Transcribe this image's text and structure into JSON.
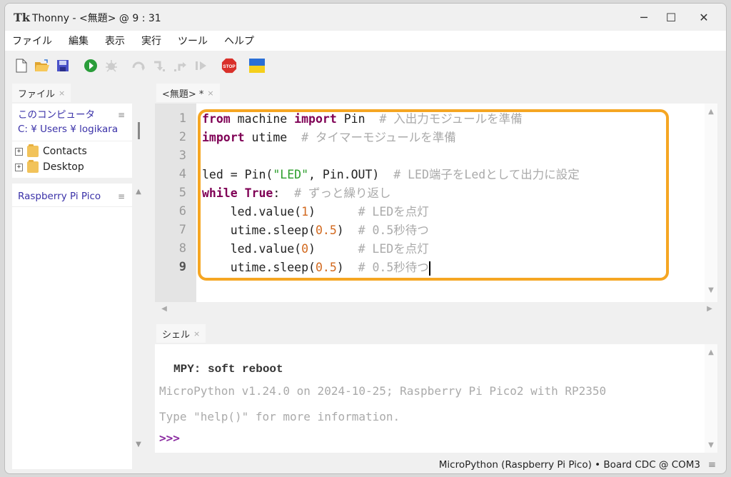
{
  "window": {
    "title": "Thonny  -  <無題>  @  9 : 31",
    "app_icon": "Tk",
    "controls": {
      "minimize": "─",
      "maximize": "☐",
      "close": "✕"
    }
  },
  "menubar": {
    "items": [
      "ファイル",
      "編集",
      "表示",
      "実行",
      "ツール",
      "ヘルプ"
    ]
  },
  "toolbar": {
    "buttons": [
      {
        "name": "new-file",
        "icon": "new-file-icon",
        "enabled": true
      },
      {
        "name": "open-file",
        "icon": "open-folder-icon",
        "enabled": true
      },
      {
        "name": "save",
        "icon": "save-icon",
        "enabled": true
      },
      {
        "name": "run",
        "icon": "run-icon",
        "enabled": true
      },
      {
        "name": "debug",
        "icon": "debug-icon",
        "enabled": false
      },
      {
        "name": "step-over",
        "icon": "step-over-icon",
        "enabled": false
      },
      {
        "name": "step-into",
        "icon": "step-into-icon",
        "enabled": false
      },
      {
        "name": "step-out",
        "icon": "step-out-icon",
        "enabled": false
      },
      {
        "name": "resume",
        "icon": "resume-icon",
        "enabled": false
      },
      {
        "name": "stop",
        "icon": "stop-icon",
        "enabled": true,
        "label": "STOP"
      },
      {
        "name": "ukraine-flag",
        "icon": "ukraine-flag-icon",
        "enabled": true
      }
    ]
  },
  "files_panel": {
    "tab_label": "ファイル",
    "computer": {
      "title": "このコンピュータ",
      "path": "C: ¥ Users ¥ logikara",
      "items": [
        "Contacts",
        "Desktop"
      ]
    },
    "device": {
      "title": "Raspberry Pi Pico"
    },
    "menu_glyph": "≡"
  },
  "editor": {
    "tab_label": "<無題> *",
    "line_numbers": [
      "1",
      "2",
      "3",
      "4",
      "5",
      "6",
      "7",
      "8",
      "9"
    ],
    "current_line": 9,
    "lines": [
      [
        {
          "t": "kw",
          "v": "from"
        },
        {
          "t": "tx",
          "v": " machine "
        },
        {
          "t": "kw",
          "v": "import"
        },
        {
          "t": "tx",
          "v": " Pin  "
        },
        {
          "t": "cm",
          "v": "# 入出力モジュールを準備"
        }
      ],
      [
        {
          "t": "kw",
          "v": "import"
        },
        {
          "t": "tx",
          "v": " utime  "
        },
        {
          "t": "cm",
          "v": "# タイマーモジュールを準備"
        }
      ],
      [],
      [
        {
          "t": "tx",
          "v": "led = Pin("
        },
        {
          "t": "st",
          "v": "\"LED\""
        },
        {
          "t": "tx",
          "v": ", Pin.OUT)  "
        },
        {
          "t": "cm",
          "v": "# LED端子をLedとして出力に設定"
        }
      ],
      [
        {
          "t": "kw",
          "v": "while"
        },
        {
          "t": "tx",
          "v": " "
        },
        {
          "t": "kw",
          "v": "True"
        },
        {
          "t": "tx",
          "v": ":  "
        },
        {
          "t": "cm",
          "v": "# ずっと繰り返し"
        }
      ],
      [
        {
          "t": "tx",
          "v": "    led.value("
        },
        {
          "t": "nm",
          "v": "1"
        },
        {
          "t": "tx",
          "v": ")      "
        },
        {
          "t": "cm",
          "v": "# LEDを点灯"
        }
      ],
      [
        {
          "t": "tx",
          "v": "    utime.sleep("
        },
        {
          "t": "nm",
          "v": "0.5"
        },
        {
          "t": "tx",
          "v": ")  "
        },
        {
          "t": "cm",
          "v": "# 0.5秒待つ"
        }
      ],
      [
        {
          "t": "tx",
          "v": "    led.value("
        },
        {
          "t": "nm",
          "v": "0"
        },
        {
          "t": "tx",
          "v": ")      "
        },
        {
          "t": "cm",
          "v": "# LEDを点灯"
        }
      ],
      [
        {
          "t": "tx",
          "v": "    utime.sleep("
        },
        {
          "t": "nm",
          "v": "0.5"
        },
        {
          "t": "tx",
          "v": ")  "
        },
        {
          "t": "cm",
          "v": "# 0.5秒待つ"
        }
      ]
    ],
    "highlight_color": "#f5a623"
  },
  "shell": {
    "tab_label": "シェル",
    "lines": {
      "reboot": "MPY: soft reboot",
      "version": "MicroPython v1.24.0 on 2024-10-25; Raspberry Pi Pico2 with RP2350",
      "help": "Type \"help()\" for more information.",
      "prompt": ">>>"
    }
  },
  "statusbar": {
    "text": "MicroPython (Raspberry Pi Pico)  •  Board CDC @ COM3",
    "menu_glyph": "≡"
  },
  "scroll": {
    "up": "▲",
    "down": "▼",
    "left": "◀",
    "right": "▶"
  },
  "tab_close": "×"
}
